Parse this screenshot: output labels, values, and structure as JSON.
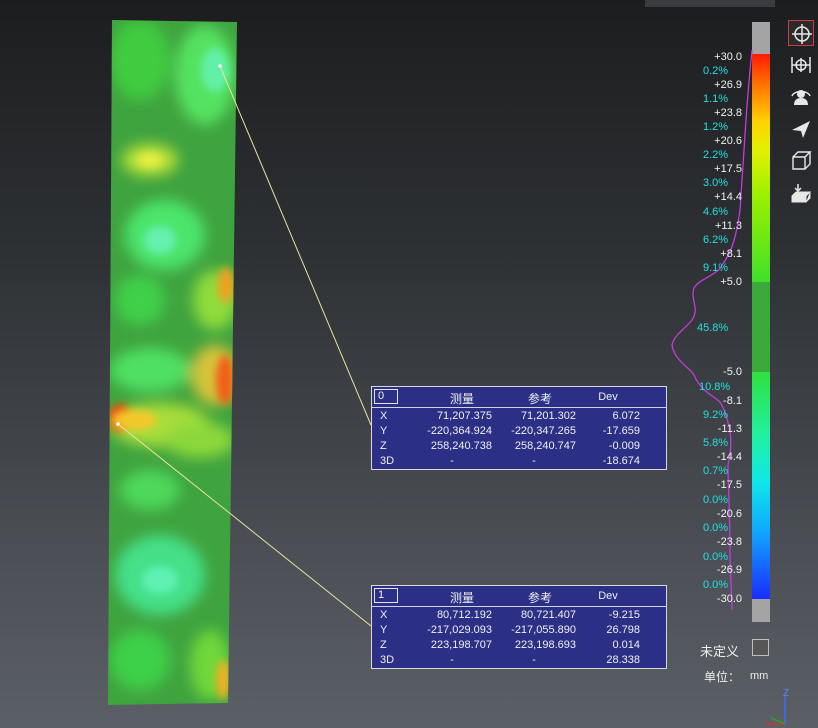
{
  "callouts": [
    {
      "id": "0",
      "headers": [
        "测量",
        "参考",
        "Dev"
      ],
      "rows": [
        {
          "axis": "X",
          "measured": "71,207.375",
          "reference": "71,201.302",
          "dev": "6.072"
        },
        {
          "axis": "Y",
          "measured": "-220,364.924",
          "reference": "-220,347.265",
          "dev": "-17.659"
        },
        {
          "axis": "Z",
          "measured": "258,240.738",
          "reference": "258,240.747",
          "dev": "-0.009"
        },
        {
          "axis": "3D",
          "measured": "-",
          "reference": "-",
          "dev": "-18.674"
        }
      ]
    },
    {
      "id": "1",
      "headers": [
        "测量",
        "参考",
        "Dev"
      ],
      "rows": [
        {
          "axis": "X",
          "measured": "80,712.192",
          "reference": "80,721.407",
          "dev": "-9.215"
        },
        {
          "axis": "Y",
          "measured": "-217,029.093",
          "reference": "-217,055.890",
          "dev": "26.798"
        },
        {
          "axis": "Z",
          "measured": "223,198.707",
          "reference": "223,198.693",
          "dev": "0.014"
        },
        {
          "axis": "3D",
          "measured": "-",
          "reference": "-",
          "dev": "28.338"
        }
      ]
    }
  ],
  "color_scale": {
    "ticks": [
      "+30.0",
      "+26.9",
      "+23.8",
      "+20.6",
      "+17.5",
      "+14.4",
      "+11.3",
      "+8.1",
      "+5.0",
      "-5.0",
      "-8.1",
      "-11.3",
      "-14.4",
      "-17.5",
      "-20.6",
      "-23.8",
      "-26.9",
      "-30.0"
    ],
    "percentages": [
      "0.2%",
      "1.1%",
      "1.2%",
      "2.2%",
      "3.0%",
      "4.6%",
      "6.2%",
      "9.1%",
      "45.8%",
      "10.8%",
      "9.2%",
      "5.8%",
      "0.7%",
      "0.0%",
      "0.0%",
      "0.0%",
      "0.0%"
    ],
    "colors": {
      "above_max": "#a4a4a4",
      "max": "#ff1a00",
      "nominal": "#3aa83a",
      "min": "#1a2cff",
      "below_min": "#a4a4a4",
      "histogram": "#c23cd8",
      "percent_text": "#23e0e0"
    }
  },
  "undefined_label": "未定义",
  "unit_label": "单位：",
  "unit_value": "mm",
  "axis_label": "Z",
  "toolbar": [
    "align-icon",
    "scale-arrows-icon",
    "user-view-icon",
    "send-arrow-icon",
    "cube-view-icon",
    "stack-icon"
  ]
}
